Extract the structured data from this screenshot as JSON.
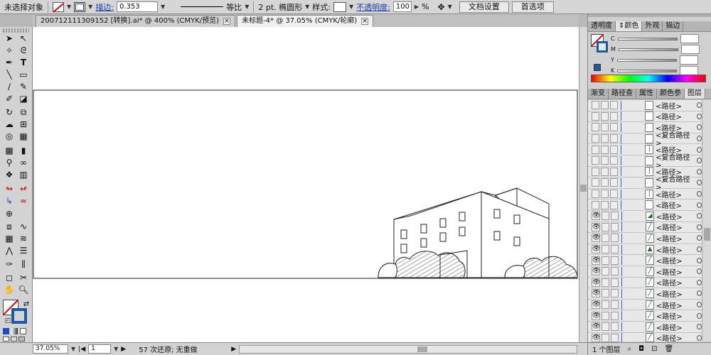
{
  "control_bar": {
    "selection_status": "未选择对象",
    "stroke_label": "描边:",
    "stroke_weight": "0.353",
    "stroke_profile": "等比",
    "brush_value": "2 pt. 椭圆形",
    "style_label": "样式:",
    "opacity_label": "不透明度:",
    "opacity_value": "100",
    "opacity_unit": "%",
    "doc_setup_button": "文档设置",
    "preferences_button": "首选项"
  },
  "document_tabs": [
    {
      "label": "200712111309152 [转换].ai* @ 400% (CMYK/预览)",
      "active": false
    },
    {
      "label": "未标题-4* @ 37.05% (CMYK/轮廓)",
      "active": true
    }
  ],
  "status_bar": {
    "zoom": "37.05%",
    "artboard": "1",
    "info": "57 次还原; 无重做"
  },
  "color_panel": {
    "tabs": [
      "透明度",
      "颜色",
      "外观",
      "描边"
    ],
    "active_tab": "颜色",
    "channels": [
      "C",
      "M",
      "Y",
      "K"
    ]
  },
  "layers_panel": {
    "tabs": [
      "渐变",
      "路径查",
      "属性",
      "颜色参",
      "图层"
    ],
    "active_tab": "图层",
    "rows": [
      {
        "name": "<路径>",
        "visible": false,
        "thumb": ""
      },
      {
        "name": "<路径>",
        "visible": false,
        "thumb": ""
      },
      {
        "name": "<路径>",
        "visible": false,
        "thumb": ""
      },
      {
        "name": "<复合路径>",
        "visible": false,
        "thumb": ""
      },
      {
        "name": "<路径>",
        "visible": false,
        "thumb": "|"
      },
      {
        "name": "<复合路径>",
        "visible": false,
        "thumb": ""
      },
      {
        "name": "<路径>",
        "visible": false,
        "thumb": "|"
      },
      {
        "name": "<复合路径>",
        "visible": false,
        "thumb": ""
      },
      {
        "name": "<路径>",
        "visible": false,
        "thumb": "|"
      },
      {
        "name": "<路径>",
        "visible": false,
        "thumb": ""
      },
      {
        "name": "<路径>",
        "visible": true,
        "thumb": "◢"
      },
      {
        "name": "<路径>",
        "visible": true,
        "thumb": "╱"
      },
      {
        "name": "<路径>",
        "visible": true,
        "thumb": "╱"
      },
      {
        "name": "<路径>",
        "visible": true,
        "thumb": "▲"
      },
      {
        "name": "<路径>",
        "visible": true,
        "thumb": "╱"
      },
      {
        "name": "<路径>",
        "visible": true,
        "thumb": "╱"
      },
      {
        "name": "<路径>",
        "visible": true,
        "thumb": "╱"
      },
      {
        "name": "<路径>",
        "visible": true,
        "thumb": "╱"
      },
      {
        "name": "<路径>",
        "visible": true,
        "thumb": "╱"
      },
      {
        "name": "<路径>",
        "visible": true,
        "thumb": "╱"
      },
      {
        "name": "<路径>",
        "visible": true,
        "thumb": "╱"
      },
      {
        "name": "<路径>",
        "visible": true,
        "thumb": "╱"
      }
    ],
    "footer_count": "1 个图层"
  },
  "colors": {
    "canvas": "#ffffff",
    "ui_gray": "#d3d3d3",
    "link_blue": "#1a3da8",
    "layer_blue": "#3a5cc8"
  }
}
